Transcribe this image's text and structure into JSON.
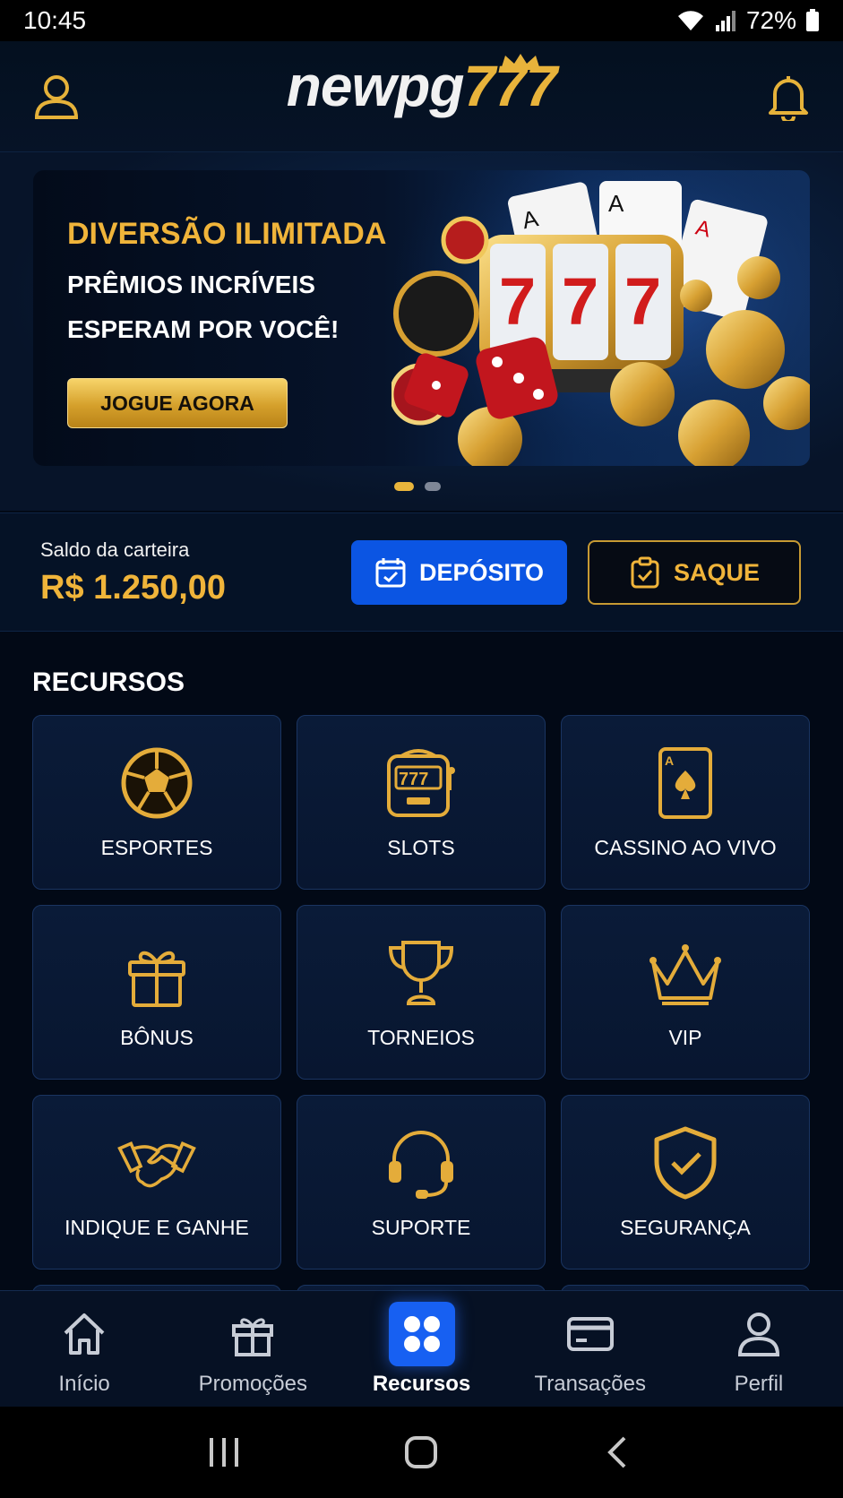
{
  "status_bar": {
    "time": "10:45",
    "battery": "72%"
  },
  "header": {
    "logo_part1": "newpg",
    "logo_part2": "777"
  },
  "banner": {
    "title": "DIVERSÃO ILIMITADA",
    "subtitle_line1": "PRÊMIOS INCRÍVEIS",
    "subtitle_line2": "ESPERAM POR VOCÊ!",
    "cta": "JOGUE AGORA",
    "slot_digits": [
      "7",
      "7",
      "7"
    ],
    "active_slide": 1,
    "slide_count": 2
  },
  "wallet": {
    "label": "Saldo da carteira",
    "amount": "R$ 1.250,00",
    "deposit_label": "DEPÓSITO",
    "withdraw_label": "SAQUE"
  },
  "resources": {
    "title": "RECURSOS",
    "items": [
      {
        "label": "ESPORTES",
        "icon": "soccer-ball-icon"
      },
      {
        "label": "SLOTS",
        "icon": "slot-machine-icon"
      },
      {
        "label": "CASSINO AO VIVO",
        "icon": "playing-card-icon"
      },
      {
        "label": "BÔNUS",
        "icon": "gift-icon"
      },
      {
        "label": "TORNEIOS",
        "icon": "trophy-icon"
      },
      {
        "label": "VIP",
        "icon": "crown-icon"
      },
      {
        "label": "INDIQUE E GANHE",
        "icon": "handshake-icon"
      },
      {
        "label": "SUPORTE",
        "icon": "headset-icon"
      },
      {
        "label": "SEGURANÇA",
        "icon": "shield-check-icon"
      }
    ]
  },
  "bottom_nav": {
    "items": [
      {
        "label": "Início",
        "icon": "home-icon"
      },
      {
        "label": "Promoções",
        "icon": "gift-icon"
      },
      {
        "label": "Recursos",
        "icon": "grid-icon"
      },
      {
        "label": "Transações",
        "icon": "card-icon"
      },
      {
        "label": "Perfil",
        "icon": "person-icon"
      }
    ],
    "active": "Recursos"
  },
  "colors": {
    "gold": "#f0b43a",
    "blue": "#0b55e3",
    "background": "#020916"
  }
}
